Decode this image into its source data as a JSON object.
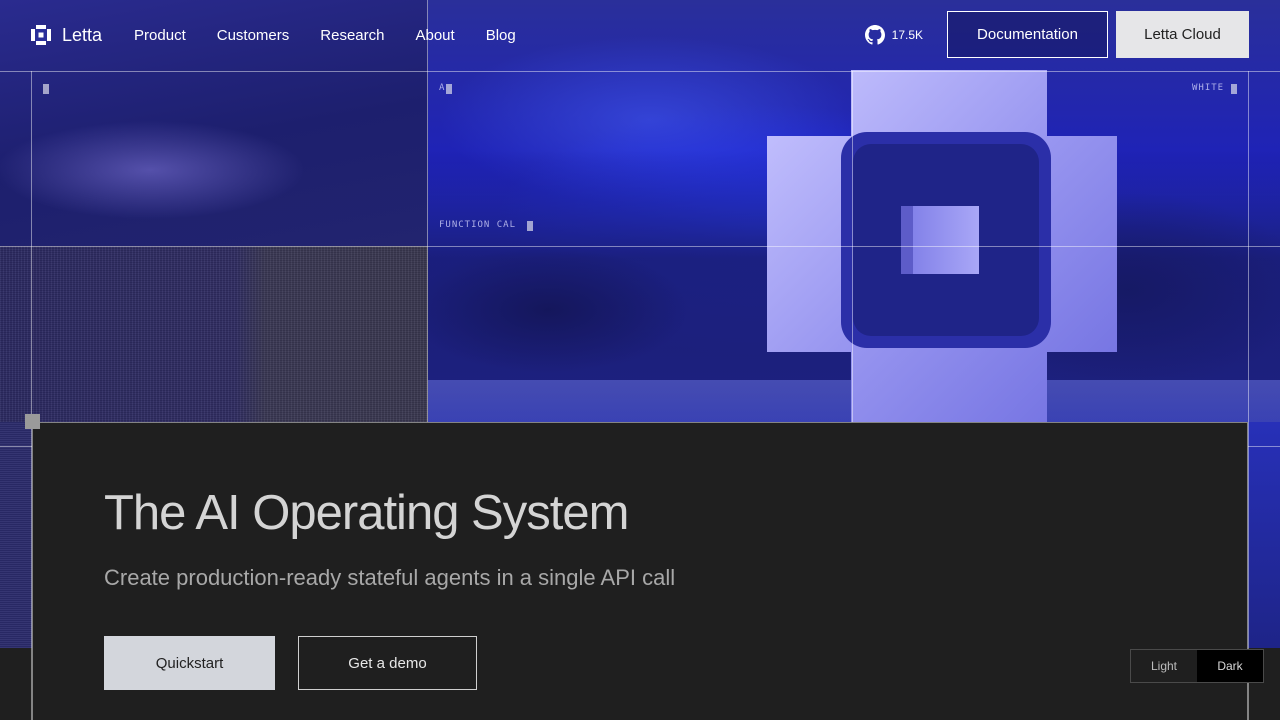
{
  "nav": {
    "logo_text": "Letta",
    "links": [
      "Product",
      "Customers",
      "Research",
      "About",
      "Blog"
    ],
    "github_stars": "17.5K",
    "documentation_label": "Documentation",
    "cloud_label": "Letta Cloud"
  },
  "hero": {
    "overlay_labels": {
      "top_left": "A",
      "top_right": "WHITE",
      "function": "FUNCTION CAL"
    }
  },
  "main": {
    "title": "The AI Operating System",
    "subtitle": "Create production-ready stateful agents in a single API call",
    "quickstart_label": "Quickstart",
    "demo_label": "Get a demo"
  },
  "theme": {
    "light_label": "Light",
    "dark_label": "Dark",
    "selected": "Dark"
  },
  "colors": {
    "accent_blue": "#2430e0",
    "card_bg": "#1f1f1f",
    "button_light": "#d3d6dc"
  }
}
